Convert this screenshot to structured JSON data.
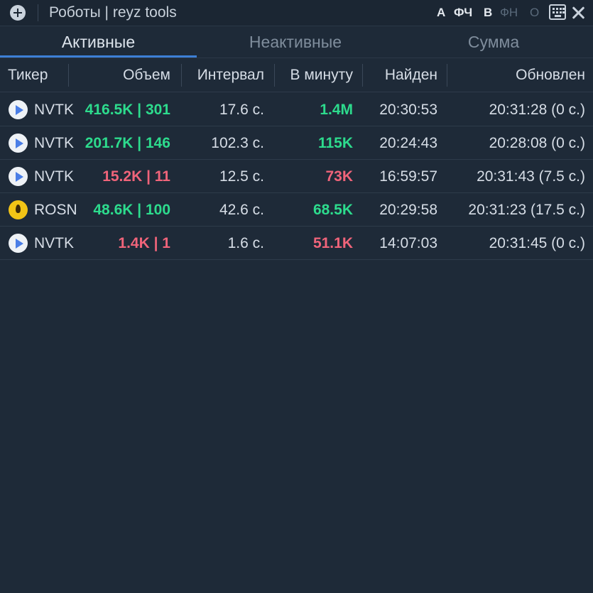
{
  "window": {
    "title": "Роботы | reyz tools",
    "controls": [
      {
        "label": "А",
        "active": true
      },
      {
        "label": "ФЧ",
        "active": true
      },
      {
        "label": "В",
        "active": true
      },
      {
        "label": "ФН",
        "active": false
      },
      {
        "label": "О",
        "active": false
      }
    ],
    "icons": {
      "add": "plus-circle-icon",
      "keyboard": "keyboard-icon",
      "close": "close-icon"
    }
  },
  "tabs": [
    {
      "label": "Активные",
      "active": true
    },
    {
      "label": "Неактивные",
      "active": false
    },
    {
      "label": "Сумма",
      "active": false
    }
  ],
  "columns": [
    "Тикер",
    "Объем",
    "Интервал",
    "В минуту",
    "Найден",
    "Обновлен"
  ],
  "rows": [
    {
      "icon": "play-logo-icon",
      "ticker": "NVTK",
      "volume": "416.5K | 301",
      "volume_color": "green",
      "interval": "17.6 с.",
      "per_minute": "1.4M",
      "per_minute_color": "green",
      "found": "20:30:53",
      "updated": "20:31:28 (0 с.)"
    },
    {
      "icon": "play-logo-icon",
      "ticker": "NVTK",
      "volume": "201.7K | 146",
      "volume_color": "green",
      "interval": "102.3 с.",
      "per_minute": "115K",
      "per_minute_color": "green",
      "found": "20:24:43",
      "updated": "20:28:08 (0 с.)"
    },
    {
      "icon": "play-logo-icon",
      "ticker": "NVTK",
      "volume": "15.2K | 11",
      "volume_color": "red",
      "interval": "12.5 с.",
      "per_minute": "73K",
      "per_minute_color": "red",
      "found": "16:59:57",
      "updated": "20:31:43 (7.5 с.)"
    },
    {
      "icon": "flame-logo-icon",
      "ticker": "ROSN",
      "volume": "48.6K | 100",
      "volume_color": "green",
      "interval": "42.6 с.",
      "per_minute": "68.5K",
      "per_minute_color": "green",
      "found": "20:29:58",
      "updated": "20:31:23 (17.5 с.)"
    },
    {
      "icon": "play-logo-icon",
      "ticker": "NVTK",
      "volume": "1.4K | 1",
      "volume_color": "red",
      "interval": "1.6 с.",
      "per_minute": "51.1K",
      "per_minute_color": "red",
      "found": "14:07:03",
      "updated": "20:31:45 (0 с.)"
    }
  ],
  "colors": {
    "green": "#2ddb8d",
    "red": "#f0647a",
    "accent": "#3d7fd6",
    "background": "#1e2a38"
  }
}
